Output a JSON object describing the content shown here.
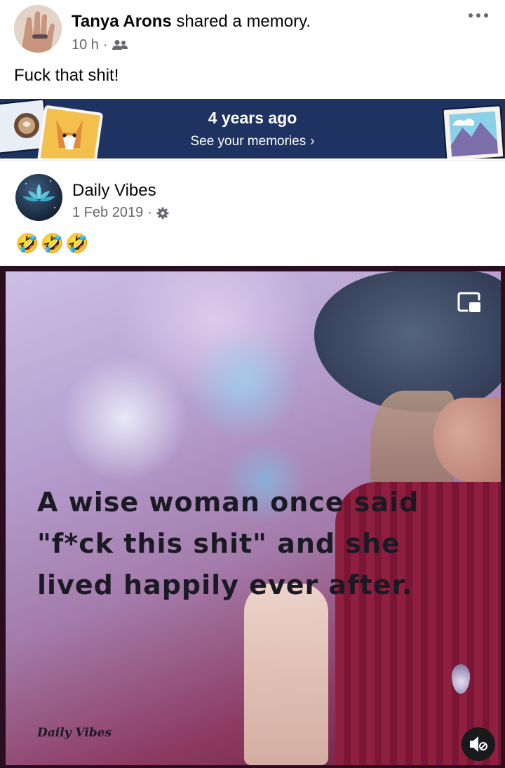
{
  "post": {
    "author": "Tanya Arons",
    "action": "shared a memory.",
    "time": "10 h",
    "audience_icon": "friends-icon",
    "text": "Fuck that shit!"
  },
  "memory_banner": {
    "title": "4 years ago",
    "link": "See your memories",
    "chevron": "›"
  },
  "shared_post": {
    "page_name": "Daily Vibes",
    "date": "1 Feb 2019",
    "audience_icon": "gear-icon",
    "emojis": "🤣🤣🤣"
  },
  "media": {
    "quote": "A wise woman once said \"f*ck this shit\" and she lived happily ever after.",
    "watermark": "Daily Vibes",
    "pip_icon": "picture-in-picture-icon",
    "mute_icon": "muted-speaker-icon"
  },
  "colors": {
    "banner_bg": "#1e3361",
    "meta_text": "#65676b",
    "media_frame": "#2a0d1e"
  }
}
